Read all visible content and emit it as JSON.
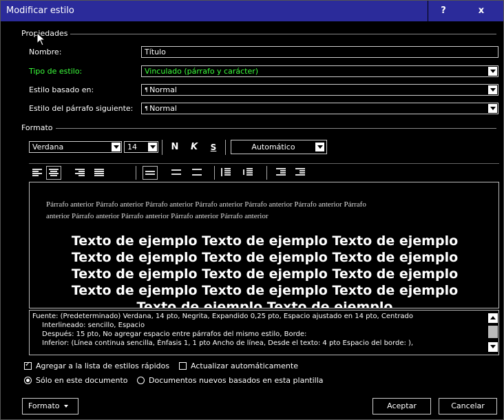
{
  "window": {
    "title": "Modificar estilo",
    "help": "?",
    "close": "x"
  },
  "properties": {
    "group_label": "Propiedades",
    "name_label": "Nombre:",
    "name_value": "Título",
    "type_label": "Tipo de estilo:",
    "type_value": "Vinculado (párrafo y carácter)",
    "based_label": "Estilo basado en:",
    "based_value": "Normal",
    "next_label": "Estilo del párrafo siguiente:",
    "next_value": "Normal",
    "paragraph_mark": "¶"
  },
  "format": {
    "group_label": "Formato",
    "font": "Verdana",
    "size": "14",
    "bold": "N",
    "italic": "K",
    "underline": "S",
    "color": "Automático"
  },
  "preview": {
    "previous_paragraph_line1": "Párrafo anterior Párrafo anterior Párrafo anterior Párrafo anterior Párrafo anterior Párrafo anterior Párrafo",
    "previous_paragraph_line2": "anterior Párrafo anterior Párrafo anterior Párrafo anterior Párrafo anterior",
    "sample_line": "Texto de ejemplo Texto de ejemplo Texto de ejemplo",
    "sample_last": "Texto de ejemplo Texto de ejemplo"
  },
  "description": {
    "line1": "Fuente: (Predeterminado) Verdana, 14 pto, Negrita, Expandido  0,25 pto, Espacio ajustado en 14 pto, Centrado",
    "line2": "Interlineado:  sencillo, Espacio",
    "line3": "Después:  15 pto, No agregar espacio entre párrafos del mismo estilo, Borde:",
    "line4": "Inferior: (Línea continua sencilla, Énfasis 1,  1 pto Ancho de línea, Desde el texto:  4 pto Espacio del borde: ),"
  },
  "options": {
    "add_quick_styles": "Agregar a la lista de estilos rápidos",
    "add_quick_styles_checked": true,
    "auto_update": "Actualizar automáticamente",
    "auto_update_checked": false,
    "only_this_doc": "Sólo en este documento",
    "new_docs": "Documentos nuevos basados en esta plantilla",
    "selected_scope": "only_this_doc"
  },
  "buttons": {
    "format": "Formato",
    "ok": "Aceptar",
    "cancel": "Cancelar"
  },
  "colors": {
    "titlebar": "#2b2b9a",
    "style_type_highlight": "#3cff3c"
  }
}
